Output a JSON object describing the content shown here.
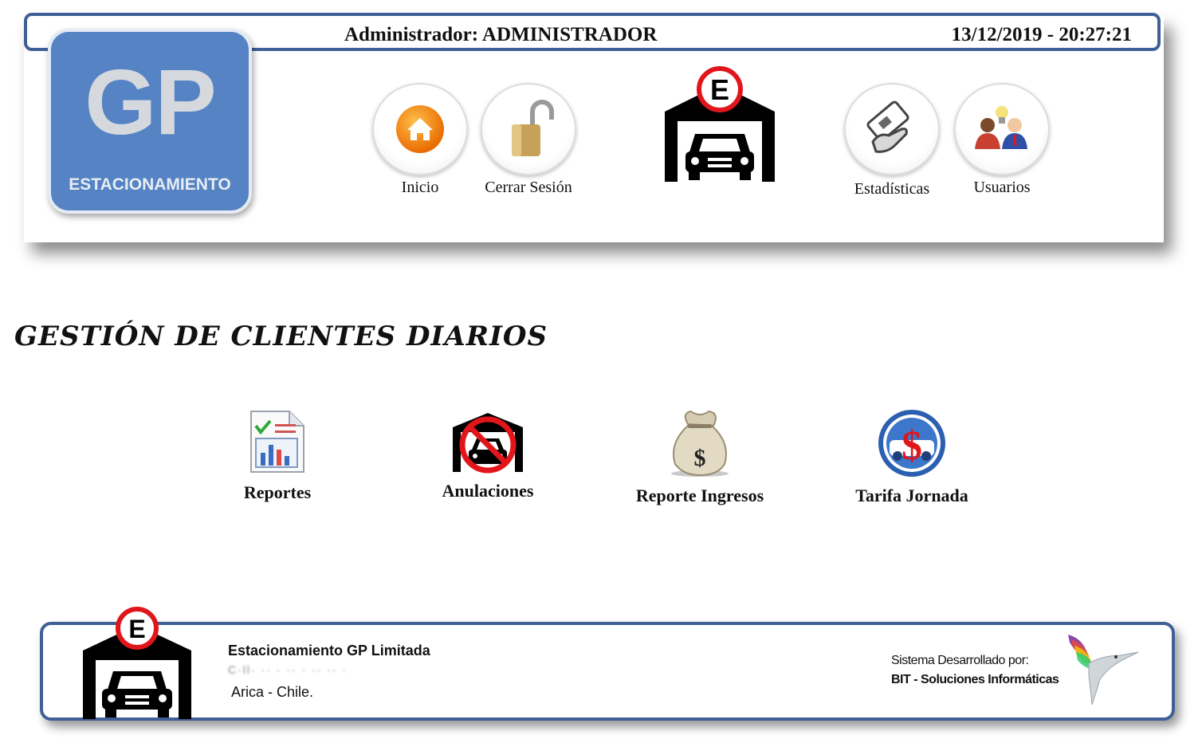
{
  "header": {
    "user_label": "Administrador: ADMINISTRADOR",
    "datetime": "13/12/2019 - 20:27:21",
    "logo_text": "GP",
    "logo_subtitle": "ESTACIONAMIENTO",
    "nav": [
      {
        "label": "Inicio",
        "icon": "home-icon"
      },
      {
        "label": "Cerrar Sesión",
        "icon": "padlock-icon"
      },
      {
        "label": "Estadísticas",
        "icon": "ticket-hand-icon"
      },
      {
        "label": "Usuarios",
        "icon": "users-icon"
      }
    ],
    "center_logo_letter": "E"
  },
  "main": {
    "section_title": "GESTIÓN DE CLIENTES DIARIOS",
    "actions": [
      {
        "label": "Reportes",
        "icon": "report-chart-icon"
      },
      {
        "label": "Anulaciones",
        "icon": "no-parking-car-icon"
      },
      {
        "label": "Reporte Ingresos",
        "icon": "money-bag-icon"
      },
      {
        "label": "Tarifa Jornada",
        "icon": "dollar-car-icon"
      }
    ]
  },
  "footer": {
    "company": "Estacionamiento GP Limitada",
    "street": "C·ll· ·· · ·· ·  ·· ·· ·",
    "city": "Arica - Chile.",
    "developed_by": "Sistema Desarrollado por:",
    "developer": "BIT - Soluciones Informáticas",
    "logo_letter": "E"
  },
  "colors": {
    "border_blue": "#3f5f96",
    "logo_blue": "#5583c4",
    "parking_red": "#e0161b"
  }
}
